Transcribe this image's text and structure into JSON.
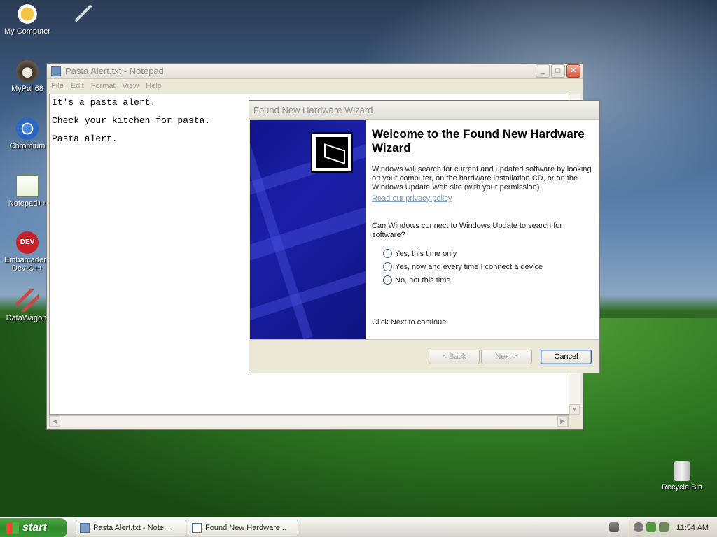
{
  "desktop": {
    "icons": [
      {
        "label": "My Computer"
      },
      {
        "label": ""
      },
      {
        "label": "MyPal 68"
      },
      {
        "label": "Chromium"
      },
      {
        "label": "Notepad++"
      },
      {
        "label": "Embarcadero Dev-C++"
      },
      {
        "label": "DataWagon."
      },
      {
        "label": "Recycle Bin"
      }
    ]
  },
  "notepad": {
    "title": "Pasta Alert.txt - Notepad",
    "menu": [
      "File",
      "Edit",
      "Format",
      "View",
      "Help"
    ],
    "lines": [
      "It's a pasta alert.",
      "Check your kitchen for pasta.",
      "Pasta alert."
    ]
  },
  "wizard": {
    "title": "Found New Hardware Wizard",
    "heading": "Welcome to the Found New Hardware Wizard",
    "intro": "Windows will search for current and updated software by looking on your computer, on the hardware installation CD, or on the Windows Update Web site (with your permission).",
    "privacy_link": "Read our privacy policy",
    "question": "Can Windows connect to Windows Update to search for software?",
    "options": [
      "Yes, this time only",
      "Yes, now and every time I connect a device",
      "No, not this time"
    ],
    "selected_option": null,
    "continue_text": "Click Next to continue.",
    "buttons": {
      "back": "< Back",
      "next": "Next >",
      "cancel": "Cancel"
    }
  },
  "taskbar": {
    "start_label": "start",
    "tasks": [
      "Pasta Alert.txt - Note...",
      "Found New Hardware..."
    ],
    "clock": "11:54 AM"
  },
  "colors": {
    "wizard_art": "#1b1fa8",
    "start_green": "#2f8a2b",
    "link": "#7a9cc8"
  }
}
